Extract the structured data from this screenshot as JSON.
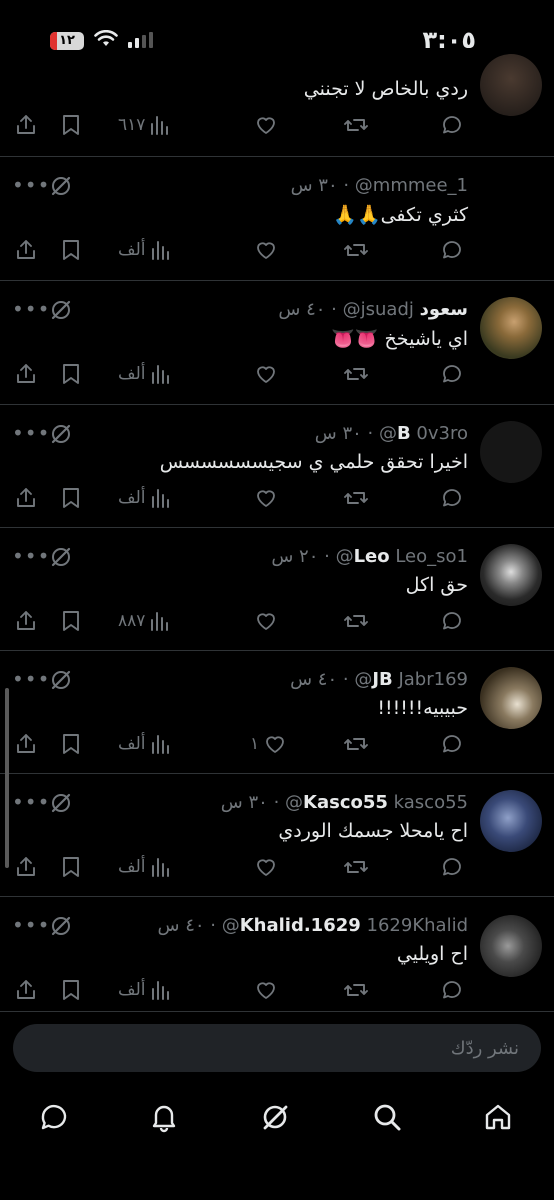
{
  "status_bar": {
    "time": "٣:٠٥",
    "battery": "١٢"
  },
  "tweets": [
    {
      "name": "",
      "handle": "",
      "time": "",
      "text": "ردي بالخاص لا تجنني",
      "views": "٦١٧",
      "likes": ""
    },
    {
      "name": "",
      "handle": "mmmee_1@",
      "time": "٣٠ س",
      "text": "كثري تكفى🙏🙏",
      "views": "ألف",
      "likes": ""
    },
    {
      "name": "سعود",
      "handle": "jsuadj@",
      "time": "٤٠ س",
      "text": "اي ياشيخخ 👅👅",
      "views": "ألف",
      "likes": ""
    },
    {
      "name": "B",
      "handle": "0v3ro@",
      "time": "٣٠ س",
      "text": "اخيرا تحقق حلمي ي سجيسسسسسس",
      "views": "ألف",
      "likes": ""
    },
    {
      "name": "Leo",
      "handle": "Leo_so1@",
      "time": "٢٠ س",
      "text": "حق اكل",
      "views": "٨٨٧",
      "likes": ""
    },
    {
      "name": "JB",
      "handle": "Jabr169@",
      "time": "٤٠ س",
      "text": "حبيبيه!!!!!!",
      "views": "ألف",
      "likes": "١"
    },
    {
      "name": "Kasco55",
      "handle": "kasco55@",
      "time": "٣٠ س",
      "text": "اح يامحلا جسمك الوردي",
      "views": "ألف",
      "likes": ""
    },
    {
      "name": "Khalid.1629",
      "handle": "1629Khalid@",
      "time": "٤٠ س",
      "text": "اح اويليي",
      "views": "ألف",
      "likes": ""
    }
  ],
  "compose": {
    "placeholder": "نشر ردّك"
  },
  "nav": [
    "home-icon",
    "search-icon",
    "grok-icon",
    "notifications-icon",
    "messages-icon"
  ],
  "colors": {
    "background": "#000000",
    "text": "#e7e9ea",
    "muted": "#71767b",
    "divider": "#2f3336",
    "battery_low": "#e0322f"
  }
}
